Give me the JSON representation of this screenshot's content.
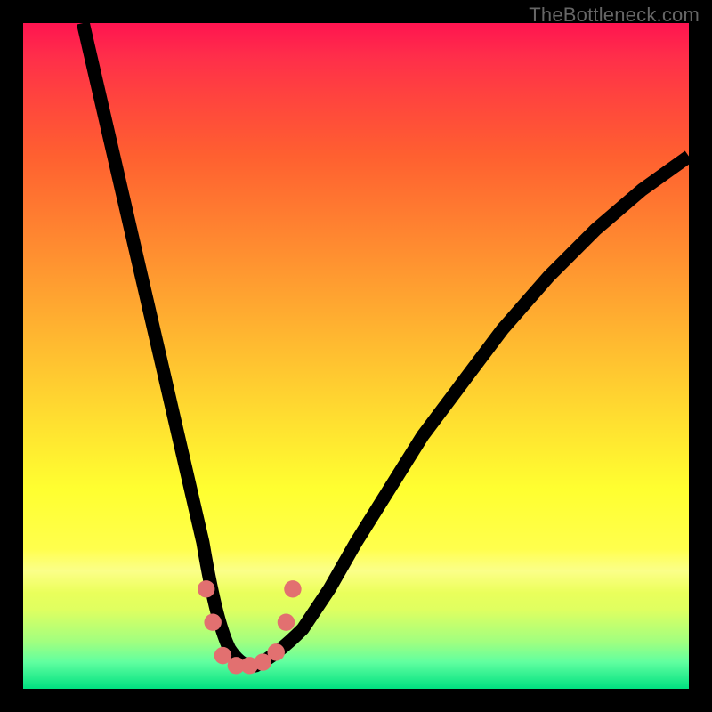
{
  "watermark": "TheBottleneck.com",
  "chart_data": {
    "type": "line",
    "title": "",
    "xlabel": "",
    "ylabel": "",
    "x_range": [
      0,
      100
    ],
    "y_range": [
      0,
      100
    ],
    "series": [
      {
        "name": "bottleneck-curve",
        "x": [
          9,
          12,
          15,
          18,
          21,
          24,
          27,
          29,
          31,
          33,
          35,
          38,
          42,
          46,
          50,
          55,
          60,
          66,
          72,
          79,
          86,
          93,
          100
        ],
        "y": [
          100,
          87,
          74,
          61,
          48,
          35,
          22,
          13,
          7,
          4,
          4,
          5,
          9,
          15,
          22,
          30,
          38,
          46,
          54,
          62,
          69,
          75,
          80
        ]
      }
    ],
    "markers": {
      "name": "highlight-dots",
      "color": "#e27070",
      "points": [
        {
          "x": 27.5,
          "y": 15
        },
        {
          "x": 28.5,
          "y": 10
        },
        {
          "x": 30,
          "y": 5
        },
        {
          "x": 32,
          "y": 3.5
        },
        {
          "x": 34,
          "y": 3.5
        },
        {
          "x": 36,
          "y": 4
        },
        {
          "x": 38,
          "y": 5.5
        },
        {
          "x": 39.5,
          "y": 10
        },
        {
          "x": 40.5,
          "y": 15
        }
      ]
    },
    "gradient_stops": [
      {
        "pos": 0,
        "color": "#ff1450"
      },
      {
        "pos": 50,
        "color": "#ffc030"
      },
      {
        "pos": 80,
        "color": "#ffff50"
      },
      {
        "pos": 100,
        "color": "#00e080"
      }
    ]
  }
}
